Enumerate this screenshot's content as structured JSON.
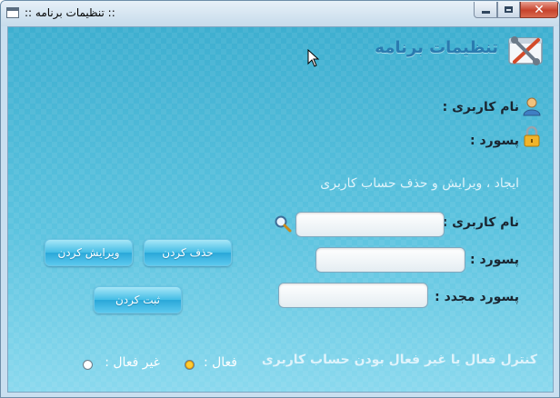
{
  "window": {
    "title": ":: تنظیمات برنامه ::",
    "close_symbol": "✕"
  },
  "header": {
    "title": "تنظیمات برنامه",
    "icon": "tools-icon"
  },
  "current_user": {
    "username_label": "نام کاربری :",
    "username_icon": "user-icon",
    "password_label": "پسورد :",
    "password_icon": "padlock-icon"
  },
  "account_section": {
    "heading": "ایجاد ، ویرایش  و حذف حساب کاربری",
    "username_label": "نام کاربری :",
    "username_value": "",
    "search_icon": "magnifier-icon",
    "password_label": "پسورد :",
    "password_value": "",
    "confirm_label": "پسورد مجدد :",
    "confirm_value": ""
  },
  "buttons": {
    "delete": "حذف کردن",
    "edit": "ویرایش کردن",
    "register": "ثبت کردن"
  },
  "status_section": {
    "heading": "کنترل فعال یا غیر فعال بودن حساب کاربری",
    "active_label": "فعال :",
    "inactive_label": "غیر فعال :",
    "selected": "active"
  },
  "colors": {
    "background": "#4eb6d4",
    "title_text": "#2a7bb0",
    "button": "#43bde6"
  }
}
